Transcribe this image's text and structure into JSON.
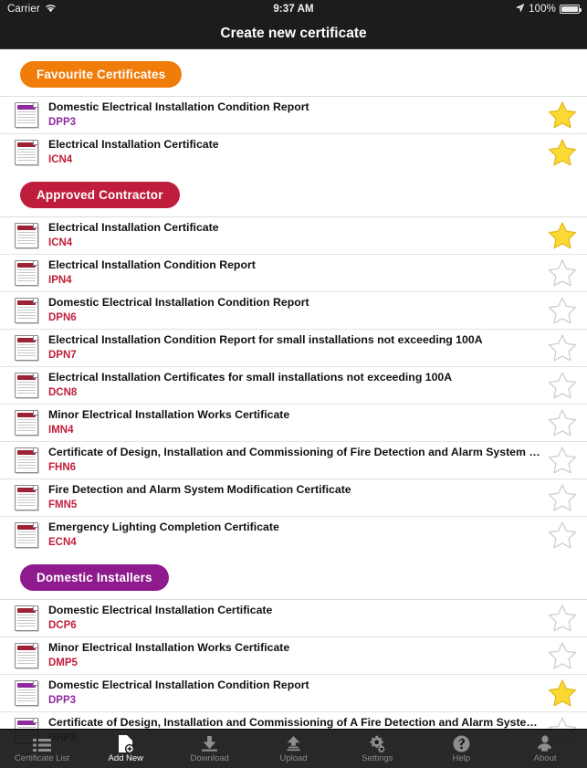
{
  "statusbar": {
    "carrier": "Carrier",
    "wifi_icon": "wifi-icon",
    "time": "9:37 AM",
    "location_icon": "location-arrow-icon",
    "battery_pct": "100%",
    "battery_icon": "battery-full-icon"
  },
  "navbar": {
    "title": "Create new certificate"
  },
  "colors": {
    "favourite_badge": "#F07C0A",
    "approved_badge": "#BE1E3C",
    "domestic_badge": "#8E1A8E",
    "code_red": "#C0203C",
    "code_purple": "#8E2A9E",
    "star_filled": "#FBD932",
    "star_empty": "#CFCFCF"
  },
  "sections": [
    {
      "badge": "Favourite Certificates",
      "badge_color": "#F07C0A",
      "rows": [
        {
          "title": "Domestic Electrical Installation Condition Report",
          "code": "DPP3",
          "code_color": "#8E2A9E",
          "bar_color": "#8E2A9E",
          "favourite": true
        },
        {
          "title": "Electrical Installation Certificate",
          "code": "ICN4",
          "code_color": "#C0203C",
          "bar_color": "#9E2235",
          "favourite": true
        }
      ]
    },
    {
      "badge": "Approved Contractor",
      "badge_color": "#BE1E3C",
      "rows": [
        {
          "title": "Electrical Installation Certificate",
          "code": "ICN4",
          "code_color": "#C0203C",
          "bar_color": "#9E2235",
          "favourite": true
        },
        {
          "title": "Electrical Installation Condition Report",
          "code": "IPN4",
          "code_color": "#C0203C",
          "bar_color": "#9E2235",
          "favourite": false
        },
        {
          "title": "Domestic Electrical Installation Condition Report",
          "code": "DPN6",
          "code_color": "#C0203C",
          "bar_color": "#9E2235",
          "favourite": false
        },
        {
          "title": "Electrical Installation Condition Report for small installations not exceeding 100A",
          "code": "DPN7",
          "code_color": "#C0203C",
          "bar_color": "#9E2235",
          "favourite": false
        },
        {
          "title": "Electrical Installation Certificates for small installations not exceeding 100A",
          "code": "DCN8",
          "code_color": "#C0203C",
          "bar_color": "#9E2235",
          "favourite": false
        },
        {
          "title": "Minor Electrical Installation Works Certificate",
          "code": "IMN4",
          "code_color": "#C0203C",
          "bar_color": "#9E2235",
          "favourite": false
        },
        {
          "title": "Certificate of Design, Installation and Commissioning of Fire Detection and Alarm System of Grade B...",
          "code": "FHN6",
          "code_color": "#C0203C",
          "bar_color": "#9E2235",
          "favourite": false
        },
        {
          "title": "Fire Detection and Alarm System Modification Certificate",
          "code": "FMN5",
          "code_color": "#C0203C",
          "bar_color": "#9E2235",
          "favourite": false
        },
        {
          "title": "Emergency Lighting Completion Certificate",
          "code": "ECN4",
          "code_color": "#C0203C",
          "bar_color": "#9E2235",
          "favourite": false
        }
      ]
    },
    {
      "badge": "Domestic Installers",
      "badge_color": "#8E1A8E",
      "rows": [
        {
          "title": "Domestic Electrical Installation Certificate",
          "code": "DCP6",
          "code_color": "#C0203C",
          "bar_color": "#9E2235",
          "favourite": false
        },
        {
          "title": "Minor Electrical Installation Works Certificate",
          "code": "DMP5",
          "code_color": "#C0203C",
          "bar_color": "#9E2235",
          "favourite": false
        },
        {
          "title": "Domestic Electrical Installation Condition Report",
          "code": "DPP3",
          "code_color": "#8E2A9E",
          "bar_color": "#8E2A9E",
          "favourite": true
        },
        {
          "title": "Certificate of Design, Installation and Commissioning of A Fire Detection and Alarm System of Grade...",
          "code": "DHP5",
          "code_color": "#8E2A9E",
          "bar_color": "#8E2A9E",
          "favourite": false
        }
      ]
    }
  ],
  "tabbar": {
    "items": [
      {
        "label": "Certificate List",
        "icon": "list-icon",
        "active": false
      },
      {
        "label": "Add New",
        "icon": "document-add-icon",
        "active": true
      },
      {
        "label": "Download",
        "icon": "download-icon",
        "active": false
      },
      {
        "label": "Upload",
        "icon": "upload-icon",
        "active": false
      },
      {
        "label": "Settings",
        "icon": "gears-icon",
        "active": false
      },
      {
        "label": "Help",
        "icon": "question-circle-icon",
        "active": false
      },
      {
        "label": "About",
        "icon": "person-icon",
        "active": false
      }
    ]
  }
}
